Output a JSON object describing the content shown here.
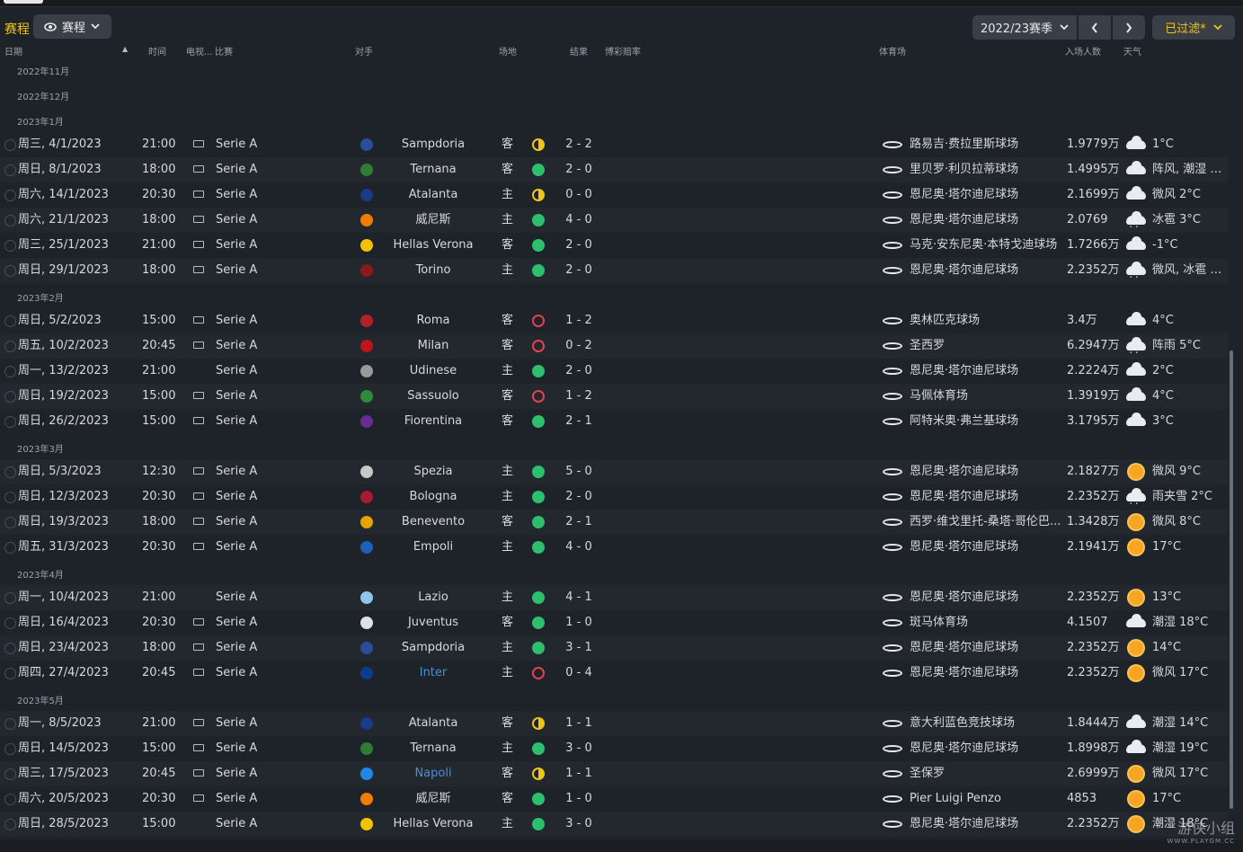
{
  "header": {
    "title": "赛程",
    "view_label": "赛程",
    "season_label": "2022/23赛季",
    "filter_label": "已过滤*"
  },
  "columns": {
    "date": "日期",
    "time": "时间",
    "tv": "电视...",
    "competition": "比赛",
    "opponent": "对手",
    "venue": "场地",
    "result": "结果",
    "odds": "博彩赔率",
    "stadium": "体育场",
    "attendance": "入场人数",
    "weather": "天气"
  },
  "months": {
    "m0": "2022年11月",
    "m1": "2022年12月",
    "m2": "2023年1月",
    "m3": "2023年2月",
    "m4": "2023年3月",
    "m5": "2023年4月",
    "m6": "2023年5月"
  },
  "fixtures": [
    {
      "date": "周三, 4/1/2023",
      "time": "21:00",
      "tv": true,
      "comp": "Serie A",
      "crest_color": "#2a4d9b",
      "opponent": "Sampdoria",
      "venue": "客",
      "result": "draw",
      "score": "2 - 2",
      "stadium": "路易吉·费拉里斯球场",
      "attendance": "1.9779万",
      "weather_icon": "cloud",
      "weather": "1°C"
    },
    {
      "date": "周日, 8/1/2023",
      "time": "18:00",
      "tv": true,
      "comp": "Serie A",
      "crest_color": "#2e7d32",
      "opponent": "Ternana",
      "venue": "客",
      "result": "win",
      "score": "2 - 0",
      "stadium": "里贝罗·利贝拉蒂球场",
      "attendance": "1.4995万",
      "weather_icon": "cloud",
      "weather": "阵风, 潮湿 9..."
    },
    {
      "date": "周六, 14/1/2023",
      "time": "20:30",
      "tv": true,
      "comp": "Serie A",
      "crest_color": "#1a3a8a",
      "opponent": "Atalanta",
      "venue": "主",
      "result": "draw",
      "score": "0 - 0",
      "stadium": "恩尼奥·塔尔迪尼球场",
      "attendance": "2.1699万",
      "weather_icon": "cloud",
      "weather": "微风 2°C"
    },
    {
      "date": "周六, 21/1/2023",
      "time": "18:00",
      "tv": true,
      "comp": "Serie A",
      "crest_color": "#f07d00",
      "opponent": "威尼斯",
      "venue": "主",
      "result": "win",
      "score": "4 - 0",
      "stadium": "恩尼奥·塔尔迪尼球场",
      "attendance": "2.0769",
      "weather_icon": "rain",
      "weather": "冰雹 3°C"
    },
    {
      "date": "周三, 25/1/2023",
      "time": "21:00",
      "tv": true,
      "comp": "Serie A",
      "crest_color": "#f2c200",
      "opponent": "Hellas Verona",
      "venue": "客",
      "result": "win",
      "score": "2 - 0",
      "stadium": "马克·安东尼奥·本特戈迪球场",
      "attendance": "1.7266万",
      "weather_icon": "cloud",
      "weather": "-1°C"
    },
    {
      "date": "周日, 29/1/2023",
      "time": "18:00",
      "tv": true,
      "comp": "Serie A",
      "crest_color": "#8b1a1a",
      "opponent": "Torino",
      "venue": "主",
      "result": "win",
      "score": "2 - 0",
      "stadium": "恩尼奥·塔尔迪尼球场",
      "attendance": "2.2352万",
      "weather_icon": "rain",
      "weather": "微风, 冰雹 3..."
    },
    {
      "date": "周日, 5/2/2023",
      "time": "15:00",
      "tv": true,
      "comp": "Serie A",
      "crest_color": "#b3202a",
      "opponent": "Roma",
      "venue": "客",
      "result": "loss",
      "score": "1 - 2",
      "stadium": "奥林匹克球场",
      "attendance": "3.4万",
      "weather_icon": "cloud",
      "weather": "4°C"
    },
    {
      "date": "周五, 10/2/2023",
      "time": "20:45",
      "tv": true,
      "comp": "Serie A",
      "crest_color": "#c0141c",
      "opponent": "Milan",
      "venue": "客",
      "result": "loss",
      "score": "0 - 2",
      "stadium": "圣西罗",
      "attendance": "6.2947万",
      "weather_icon": "rain",
      "weather": "阵雨 5°C"
    },
    {
      "date": "周一, 13/2/2023",
      "time": "21:00",
      "tv": false,
      "comp": "Serie A",
      "crest_color": "#9a9a9a",
      "opponent": "Udinese",
      "venue": "主",
      "result": "win",
      "score": "2 - 0",
      "stadium": "恩尼奥·塔尔迪尼球场",
      "attendance": "2.2224万",
      "weather_icon": "cloud",
      "weather": "2°C"
    },
    {
      "date": "周日, 19/2/2023",
      "time": "15:00",
      "tv": true,
      "comp": "Serie A",
      "crest_color": "#2e8b3a",
      "opponent": "Sassuolo",
      "venue": "客",
      "result": "loss",
      "score": "1 - 2",
      "stadium": "马佩体育场",
      "attendance": "1.3919万",
      "weather_icon": "cloud",
      "weather": "4°C"
    },
    {
      "date": "周日, 26/2/2023",
      "time": "15:00",
      "tv": true,
      "comp": "Serie A",
      "crest_color": "#6a2c91",
      "opponent": "Fiorentina",
      "venue": "客",
      "result": "win",
      "score": "2 - 1",
      "stadium": "阿特米奥·弗兰基球场",
      "attendance": "3.1795万",
      "weather_icon": "cloud",
      "weather": "3°C"
    },
    {
      "date": "周日, 5/3/2023",
      "time": "12:30",
      "tv": true,
      "comp": "Serie A",
      "crest_color": "#c8c8c8",
      "opponent": "Spezia",
      "venue": "主",
      "result": "win",
      "score": "5 - 0",
      "stadium": "恩尼奥·塔尔迪尼球场",
      "attendance": "2.1827万",
      "weather_icon": "sun",
      "weather": "微风 9°C"
    },
    {
      "date": "周日, 12/3/2023",
      "time": "20:30",
      "tv": true,
      "comp": "Serie A",
      "crest_color": "#a51c30",
      "opponent": "Bologna",
      "venue": "主",
      "result": "win",
      "score": "2 - 0",
      "stadium": "恩尼奥·塔尔迪尼球场",
      "attendance": "2.2352万",
      "weather_icon": "rain",
      "weather": "雨夹雪 2°C"
    },
    {
      "date": "周日, 19/3/2023",
      "time": "18:00",
      "tv": true,
      "comp": "Serie A",
      "crest_color": "#e5a500",
      "opponent": "Benevento",
      "venue": "客",
      "result": "win",
      "score": "2 - 1",
      "stadium": "西罗·维戈里托-桑塔·哥伦巴...",
      "attendance": "1.3428万",
      "weather_icon": "sun",
      "weather": "微风 8°C"
    },
    {
      "date": "周五, 31/3/2023",
      "time": "20:30",
      "tv": true,
      "comp": "Serie A",
      "crest_color": "#1f5fb8",
      "opponent": "Empoli",
      "venue": "主",
      "result": "win",
      "score": "4 - 0",
      "stadium": "恩尼奥·塔尔迪尼球场",
      "attendance": "2.1941万",
      "weather_icon": "sun",
      "weather": "17°C"
    },
    {
      "date": "周一, 10/4/2023",
      "time": "21:00",
      "tv": false,
      "comp": "Serie A",
      "crest_color": "#8ec5ea",
      "opponent": "Lazio",
      "venue": "主",
      "result": "win",
      "score": "4 - 1",
      "stadium": "恩尼奥·塔尔迪尼球场",
      "attendance": "2.2352万",
      "weather_icon": "sun",
      "weather": "13°C"
    },
    {
      "date": "周日, 16/4/2023",
      "time": "20:30",
      "tv": true,
      "comp": "Serie A",
      "crest_color": "#e0e0e0",
      "opponent": "Juventus",
      "venue": "客",
      "result": "win",
      "score": "1 - 0",
      "stadium": "斑马体育场",
      "attendance": "4.1507",
      "weather_icon": "cloud",
      "weather": "潮湿 18°C"
    },
    {
      "date": "周日, 23/4/2023",
      "time": "18:00",
      "tv": true,
      "comp": "Serie A",
      "crest_color": "#2a4d9b",
      "opponent": "Sampdoria",
      "venue": "主",
      "result": "win",
      "score": "3 - 1",
      "stadium": "恩尼奥·塔尔迪尼球场",
      "attendance": "2.2352万",
      "weather_icon": "sun",
      "weather": "14°C"
    },
    {
      "date": "周四, 27/4/2023",
      "time": "20:45",
      "tv": true,
      "comp": "Serie A",
      "crest_color": "#0a3d91",
      "opponent": "Inter",
      "venue": "主",
      "result": "loss",
      "score": "0 - 4",
      "stadium": "恩尼奥·塔尔迪尼球场",
      "attendance": "2.2352万",
      "weather_icon": "sun",
      "weather": "微风 17°C",
      "opponent_link": true
    },
    {
      "date": "周一, 8/5/2023",
      "time": "21:00",
      "tv": true,
      "comp": "Serie A",
      "crest_color": "#1a3a8a",
      "opponent": "Atalanta",
      "venue": "客",
      "result": "draw",
      "score": "1 - 1",
      "stadium": "意大利蓝色竞技球场",
      "attendance": "1.8444万",
      "weather_icon": "cloud",
      "weather": "潮湿 14°C"
    },
    {
      "date": "周日, 14/5/2023",
      "time": "15:00",
      "tv": true,
      "comp": "Serie A",
      "crest_color": "#2e7d32",
      "opponent": "Ternana",
      "venue": "主",
      "result": "win",
      "score": "3 - 0",
      "stadium": "恩尼奥·塔尔迪尼球场",
      "attendance": "1.8998万",
      "weather_icon": "cloud",
      "weather": "潮湿 19°C"
    },
    {
      "date": "周三, 17/5/2023",
      "time": "20:45",
      "tv": true,
      "comp": "Serie A",
      "crest_color": "#1e88e5",
      "opponent": "Napoli",
      "venue": "客",
      "result": "draw",
      "score": "1 - 1",
      "stadium": "圣保罗",
      "attendance": "2.6999万",
      "weather_icon": "sun",
      "weather": "微风 17°C",
      "opponent_link": true
    },
    {
      "date": "周六, 20/5/2023",
      "time": "20:30",
      "tv": true,
      "comp": "Serie A",
      "crest_color": "#f07d00",
      "opponent": "威尼斯",
      "venue": "客",
      "result": "win",
      "score": "1 - 0",
      "stadium": "Pier Luigi Penzo",
      "attendance": "4853",
      "weather_icon": "sun",
      "weather": "17°C"
    },
    {
      "date": "周日, 28/5/2023",
      "time": "15:00",
      "tv": false,
      "comp": "Serie A",
      "crest_color": "#f2c200",
      "opponent": "Hellas Verona",
      "venue": "主",
      "result": "win",
      "score": "3 - 0",
      "stadium": "恩尼奥·塔尔迪尼球场",
      "attendance": "2.2352万",
      "weather_icon": "sun",
      "weather": "潮湿 18°C"
    }
  ],
  "watermark": {
    "text": "游侠小组",
    "url": "WWW.PLAYGM.CC"
  }
}
